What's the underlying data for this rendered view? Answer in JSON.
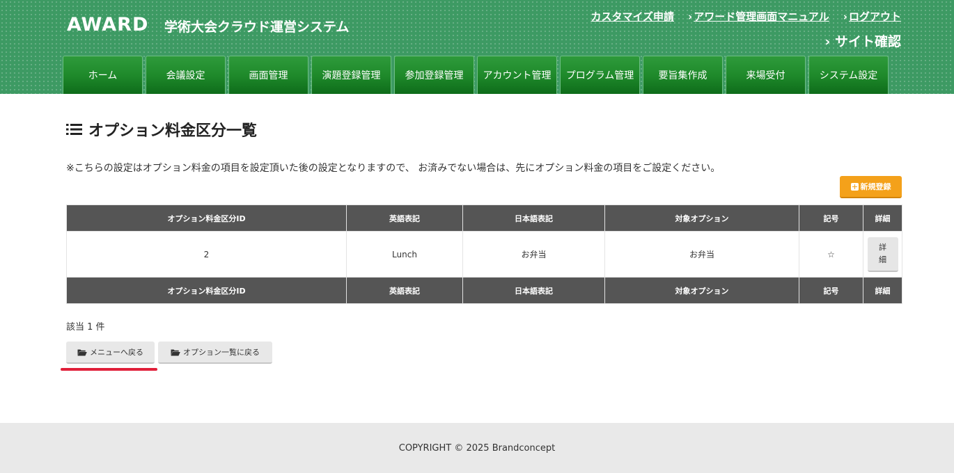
{
  "header": {
    "logo": "AWARD",
    "system_name": "学術大会クラウド運営システム",
    "top_links": [
      {
        "label": "カスタマイズ申請",
        "chevron": ""
      },
      {
        "label": "アワード管理画面マニュアル",
        "chevron": "›"
      },
      {
        "label": "ログアウト",
        "chevron": "›"
      }
    ],
    "site_check": "サイト確認",
    "site_check_chevron": "›",
    "nav_tabs": [
      "ホーム",
      "会議設定",
      "画面管理",
      "演題登録管理",
      "参加登録管理",
      "アカウント管理",
      "プログラム管理",
      "要旨集作成",
      "来場受付",
      "システム設定"
    ],
    "background_color": "#3d9a63"
  },
  "main": {
    "title": "オプション料金区分一覧",
    "title_icon": "list-icon",
    "notice": "※こちらの設定はオプション料金の項目を設定頂いた後の設定となりますので、 お済みでない場合は、先にオプション料金の項目をご設定ください。",
    "new_button": "新規登録",
    "new_button_icon": "plus-square-icon",
    "new_button_color": "#f4a11a",
    "table": {
      "headers": [
        "オプション料金区分ID",
        "英語表記",
        "日本語表記",
        "対象オプション",
        "記号",
        "詳細"
      ],
      "rows": [
        {
          "id": "2",
          "english": "Lunch",
          "japanese": "お弁当",
          "target_option": "お弁当",
          "symbol": "☆",
          "detail": "詳\n細"
        }
      ],
      "header_color": "#555555"
    },
    "count": "該当 1 件",
    "back_buttons": [
      {
        "label": "メニューへ戻る",
        "icon": "folder-open-icon"
      },
      {
        "label": "オプション一覧に戻る",
        "icon": "folder-open-icon"
      }
    ],
    "highlight_color": "#e0203a"
  },
  "footer": {
    "copyright": "COPYRIGHT © 2025 Brandconcept"
  }
}
